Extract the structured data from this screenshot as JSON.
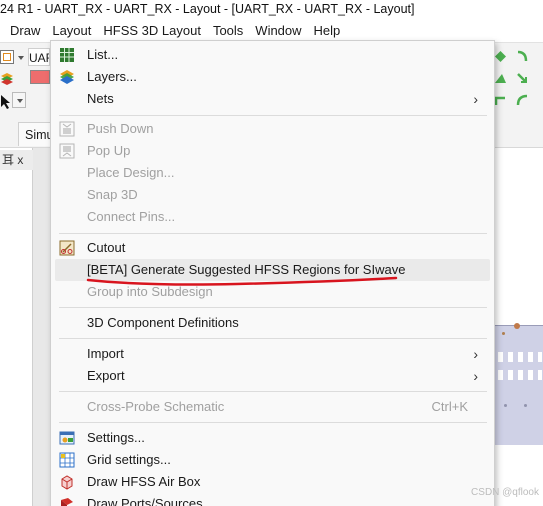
{
  "window": {
    "title": "24 R1 - UART_RX - UART_RX - Layout - [UART_RX - UART_RX - Layout]"
  },
  "menubar": {
    "items": [
      "Draw",
      "Layout",
      "HFSS 3D Layout",
      "Tools",
      "Window",
      "Help"
    ],
    "active": "Layout"
  },
  "toolbar": {
    "partial_field": "UAF",
    "tab_label": "Simu"
  },
  "left_panel": {
    "header": "耳 x"
  },
  "layout_menu": {
    "items": [
      {
        "label": "List...",
        "icon": "table-grid-icon",
        "enabled": true
      },
      {
        "label": "Layers...",
        "icon": "layers-stack-icon",
        "enabled": true
      },
      {
        "label": "Nets",
        "submenu": true,
        "enabled": true
      },
      {
        "label": "Push Down",
        "icon": "push-down-icon",
        "enabled": false
      },
      {
        "label": "Pop Up",
        "icon": "pop-up-icon",
        "enabled": false
      },
      {
        "label": "Place Design...",
        "enabled": false
      },
      {
        "label": "Snap 3D",
        "enabled": false
      },
      {
        "label": "Connect Pins...",
        "enabled": false
      },
      {
        "label": "Cutout",
        "icon": "cutout-icon",
        "enabled": true
      },
      {
        "label": "[BETA] Generate Suggested HFSS Regions for SIwave",
        "enabled": true,
        "highlighted": true
      },
      {
        "label": "Group into Subdesign",
        "enabled": false
      },
      {
        "label": "3D Component Definitions",
        "enabled": true
      },
      {
        "label": "Import",
        "submenu": true,
        "enabled": true
      },
      {
        "label": "Export",
        "submenu": true,
        "enabled": true
      },
      {
        "label": "Cross-Probe Schematic",
        "shortcut": "Ctrl+K",
        "enabled": false
      },
      {
        "label": "Settings...",
        "icon": "settings-icon",
        "enabled": true
      },
      {
        "label": "Grid settings...",
        "icon": "grid-settings-icon",
        "enabled": true
      },
      {
        "label": "Draw HFSS Air Box",
        "icon": "air-box-icon",
        "enabled": true
      },
      {
        "label": "Draw Ports/Sources",
        "icon": "ports-sources-icon",
        "enabled": true
      }
    ]
  },
  "annotation": {
    "underline_color": "#d8141e"
  },
  "watermark": "CSDN @qflook"
}
